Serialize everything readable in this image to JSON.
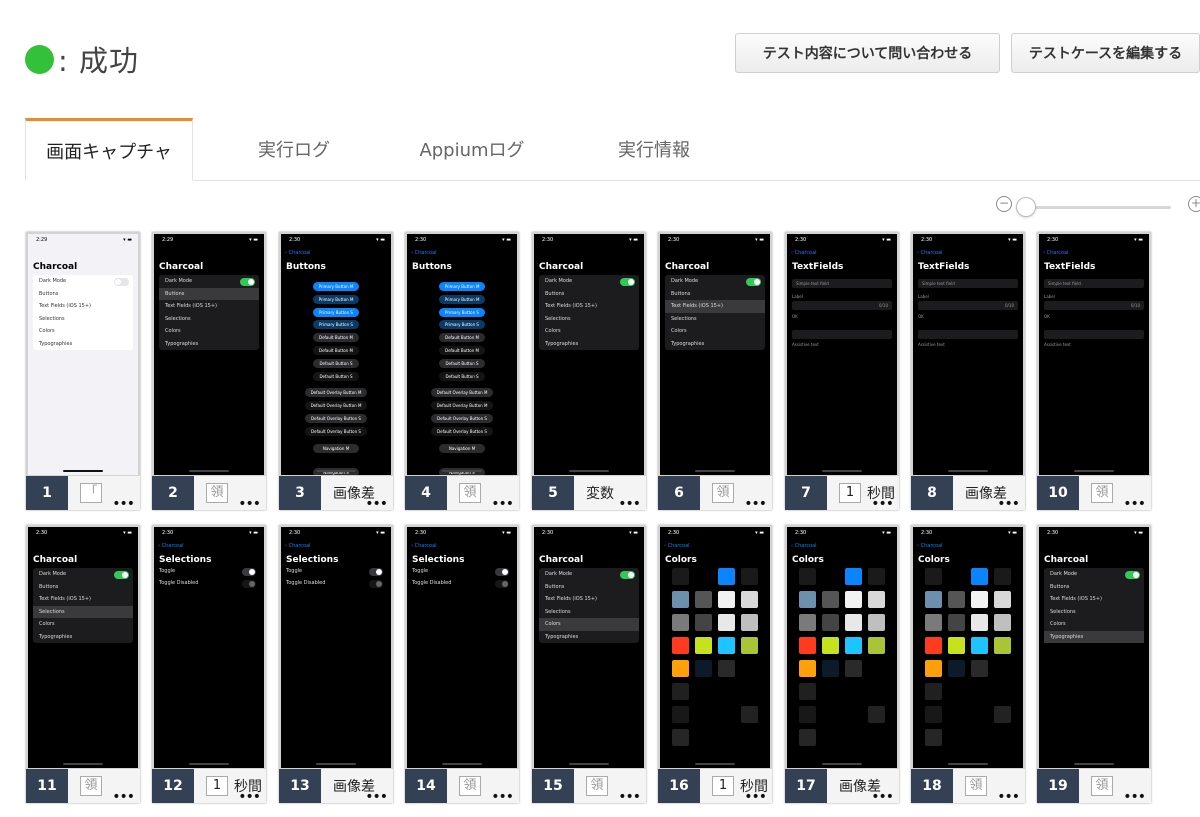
{
  "status": {
    "color": "#34c13a",
    "text": ": 成功"
  },
  "header_buttons": [
    {
      "label": "テスト内容について問い合わせる"
    },
    {
      "label": "テストケースを編集する"
    }
  ],
  "tabs": [
    {
      "label": "画面キャプチャ",
      "active": true
    },
    {
      "label": "実行ログ",
      "active": false
    },
    {
      "label": "Appiumログ",
      "active": false
    },
    {
      "label": "実行情報",
      "active": false
    }
  ],
  "zoom": {
    "minus_icon": "zoom-out-icon",
    "plus_icon": "zoom-in-icon",
    "level": 0.0
  },
  "accent_colors": {
    "tab_active": "#f08a24",
    "footer_number_bg": "#344054",
    "success": "#34c13a"
  },
  "captures": [
    {
      "n": "1",
      "kind": "menu",
      "theme": "light",
      "time": "2:29",
      "title": "Charcoal",
      "dark_on": false,
      "sel": -1,
      "action": "「",
      "action_type": "box"
    },
    {
      "n": "2",
      "kind": "menu",
      "theme": "dark",
      "time": "2:29",
      "title": "Charcoal",
      "dark_on": true,
      "sel": 1,
      "action": "領",
      "action_type": "box"
    },
    {
      "n": "3",
      "kind": "buttons",
      "theme": "dark",
      "time": "2:30",
      "title": "Buttons",
      "back": "Charcoal",
      "action": "画像差",
      "action_type": "text"
    },
    {
      "n": "4",
      "kind": "buttons",
      "theme": "dark",
      "time": "2:30",
      "title": "Buttons",
      "back": "Charcoal",
      "action": "領",
      "action_type": "box"
    },
    {
      "n": "5",
      "kind": "menu",
      "theme": "dark",
      "time": "2:30",
      "title": "Charcoal",
      "dark_on": true,
      "sel": -1,
      "action": "変数",
      "action_type": "text"
    },
    {
      "n": "6",
      "kind": "menu",
      "theme": "dark",
      "time": "2:30",
      "title": "Charcoal",
      "dark_on": true,
      "sel": 2,
      "action": "領",
      "action_type": "box"
    },
    {
      "n": "7",
      "kind": "textfields",
      "theme": "dark",
      "time": "2:30",
      "title": "TextFields",
      "back": "Charcoal",
      "action": "秒間",
      "box": "1",
      "action_type": "numbox"
    },
    {
      "n": "8",
      "kind": "textfields",
      "theme": "dark",
      "time": "2:30",
      "title": "TextFields",
      "back": "Charcoal",
      "action": "画像差",
      "action_type": "text"
    },
    {
      "n": "10",
      "kind": "textfields",
      "theme": "dark",
      "time": "2:30",
      "title": "TextFields",
      "back": "Charcoal",
      "action": "領",
      "action_type": "box"
    },
    {
      "n": "11",
      "kind": "menu",
      "theme": "dark",
      "time": "2:30",
      "title": "Charcoal",
      "dark_on": true,
      "sel": 3,
      "action": "領",
      "action_type": "box"
    },
    {
      "n": "12",
      "kind": "selections",
      "theme": "dark",
      "time": "2:30",
      "title": "Selections",
      "back": "Charcoal",
      "action": "秒間",
      "box": "1",
      "action_type": "numbox"
    },
    {
      "n": "13",
      "kind": "selections",
      "theme": "dark",
      "time": "2:30",
      "title": "Selections",
      "back": "Charcoal",
      "action": "画像差",
      "action_type": "text"
    },
    {
      "n": "14",
      "kind": "selections",
      "theme": "dark",
      "time": "2:30",
      "title": "Selections",
      "back": "Charcoal",
      "action": "領",
      "action_type": "box"
    },
    {
      "n": "15",
      "kind": "menu",
      "theme": "dark",
      "time": "2:30",
      "title": "Charcoal",
      "dark_on": true,
      "sel": 4,
      "action": "領",
      "action_type": "box"
    },
    {
      "n": "16",
      "kind": "colors",
      "theme": "dark",
      "time": "2:30",
      "title": "Colors",
      "back": "Charcoal",
      "action": "秒間",
      "box": "1",
      "action_type": "numbox"
    },
    {
      "n": "17",
      "kind": "colors",
      "theme": "dark",
      "time": "2:30",
      "title": "Colors",
      "back": "Charcoal",
      "action": "画像差",
      "action_type": "text"
    },
    {
      "n": "18",
      "kind": "colors",
      "theme": "dark",
      "time": "2:30",
      "title": "Colors",
      "back": "Charcoal",
      "action": "領",
      "action_type": "box"
    },
    {
      "n": "19",
      "kind": "menu",
      "theme": "dark",
      "time": "2:30",
      "title": "Charcoal",
      "dark_on": true,
      "sel": 5,
      "action": "領",
      "action_type": "box"
    }
  ],
  "menu_items": [
    "Dark Mode",
    "Buttons",
    "Text Fields (iOS 15+)",
    "Selections",
    "Colors",
    "Typographies"
  ],
  "button_labels": [
    {
      "t": "Primary Button M",
      "c": "#0a84ff"
    },
    {
      "t": "Primary Button M",
      "c": "#0a3a66"
    },
    {
      "t": "Primary Button S",
      "c": "#0a84ff"
    },
    {
      "t": "Primary Button S",
      "c": "#0a3a66"
    },
    {
      "t": "Default Button M",
      "c": "#2c2c2e"
    },
    {
      "t": "Default Button M",
      "c": "#151515"
    },
    {
      "t": "Default Button S",
      "c": "#2c2c2e"
    },
    {
      "t": "Default Button S",
      "c": "#151515"
    },
    {
      "t": "Default Overlay Button M",
      "c": "#2c2c2e"
    },
    {
      "t": "Default Overlay Button M",
      "c": "#151515"
    },
    {
      "t": "Default Overlay Button S",
      "c": "#2c2c2e"
    },
    {
      "t": "Default Overlay Button S",
      "c": "#151515"
    },
    {
      "t": "Navigation M",
      "c": "#2c2c2e"
    },
    {
      "t": "Navigation S",
      "c": "#2c2c2e"
    }
  ],
  "textfield_lines": {
    "placeholder": "Simple text field",
    "label": "Label",
    "ok": "OK",
    "counter": "0/10",
    "assist": "Assistive text"
  },
  "selection_lines": [
    "Toggle",
    "Toggle Disabled"
  ],
  "color_palette": [
    [
      "#1a1a1a",
      "#000000",
      "#0a84ff",
      "#1a1a1a"
    ],
    [
      "#6d8fae",
      "#555555",
      "#f2f2f2",
      "#d8d8d8"
    ],
    [
      "#7a7a7a",
      "#444444",
      "#e8e8e8",
      "#bfbfbf"
    ],
    [
      "#ff3b1f",
      "#c5e21c",
      "#1dc4ff",
      "#a9c436"
    ],
    [
      "#ff9f0a",
      "#0c1a2a",
      "#2a2a2a",
      "#000000"
    ],
    [
      "#202020",
      "#000000",
      "#000000",
      "#000000"
    ],
    [
      "#181818",
      "#000000",
      "#000000",
      "#222222"
    ],
    [
      "#262626",
      "#000000",
      "#000000",
      "#000000"
    ]
  ],
  "more_icon": "more-horizontal-icon"
}
